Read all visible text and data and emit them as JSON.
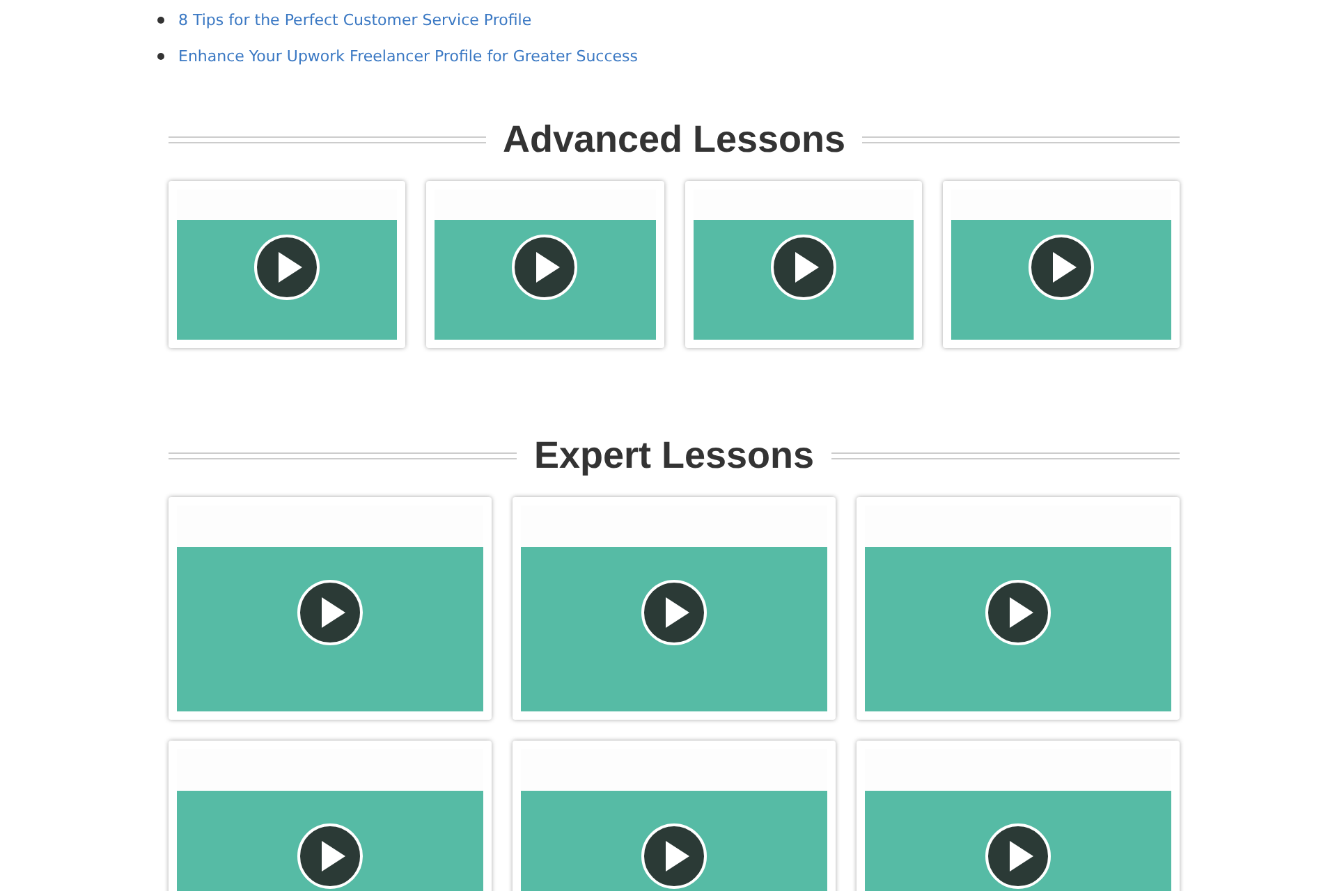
{
  "related_links": [
    "8 Tips for the Perfect Customer Service Profile",
    "Enhance Your Upwork Freelancer Profile for Greater Success"
  ],
  "sections": [
    {
      "title": "Advanced Lessons",
      "kind": "compact",
      "videos": [
        {
          "kind": "video"
        },
        {
          "kind": "video"
        },
        {
          "kind": "video"
        },
        {
          "kind": "video"
        }
      ]
    },
    {
      "title": "Expert Lessons",
      "kind": "wide",
      "videos": [
        {
          "kind": "video"
        },
        {
          "kind": "video"
        },
        {
          "kind": "video"
        },
        {
          "kind": "video"
        },
        {
          "kind": "video"
        },
        {
          "kind": "video"
        }
      ]
    }
  ]
}
